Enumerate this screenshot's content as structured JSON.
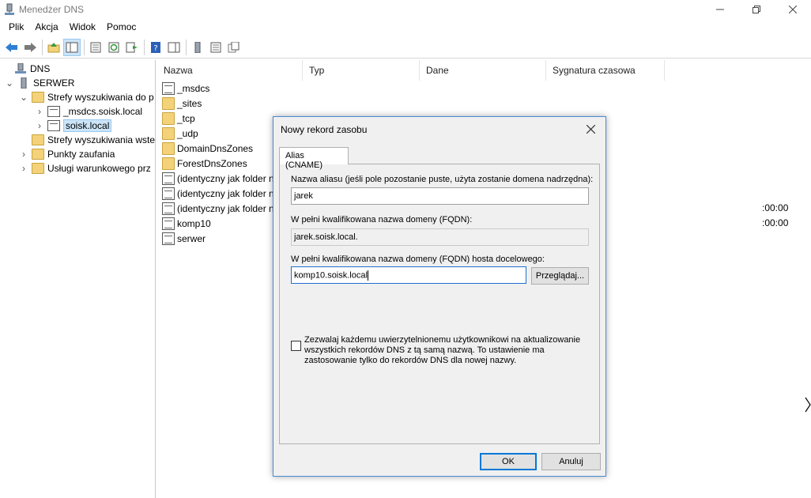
{
  "window": {
    "title": "Menedżer DNS"
  },
  "menu": [
    "Plik",
    "Akcja",
    "Widok",
    "Pomoc"
  ],
  "tree": {
    "root": "DNS",
    "server": "SERWER",
    "items": [
      {
        "label": "Strefy wyszukiwania do p"
      },
      {
        "label": "_msdcs.soisk.local"
      },
      {
        "label": "soisk.local"
      },
      {
        "label": "Strefy wyszukiwania wste"
      },
      {
        "label": "Punkty zaufania"
      },
      {
        "label": "Usługi warunkowego prz"
      }
    ]
  },
  "list": {
    "columns": [
      "Nazwa",
      "Typ",
      "Dane",
      "Sygnatura czasowa"
    ],
    "rows": [
      {
        "name": "_msdcs"
      },
      {
        "name": "_sites"
      },
      {
        "name": "_tcp"
      },
      {
        "name": "_udp"
      },
      {
        "name": "DomainDnsZones"
      },
      {
        "name": "ForestDnsZones"
      },
      {
        "name": "(identyczny jak folder n"
      },
      {
        "name": "(identyczny jak folder n"
      },
      {
        "name": "(identyczny jak folder n",
        "ts": ":00:00"
      },
      {
        "name": "komp10",
        "ts": ":00:00"
      },
      {
        "name": "serwer"
      }
    ]
  },
  "dialog": {
    "title": "Nowy rekord zasobu",
    "tab": "Alias (CNAME)",
    "alias_label": "Nazwa aliasu (jeśli pole pozostanie puste, użyta zostanie domena nadrzędna):",
    "alias_value": "jarek",
    "fqdn_label": "W pełni kwalifikowana nazwa domeny (FQDN):",
    "fqdn_value": "jarek.soisk.local.",
    "target_label": "W pełni kwalifikowana nazwa domeny (FQDN) hosta docelowego:",
    "target_value": "komp10.soisk.local",
    "browse": "Przeglądaj...",
    "checkbox_label": "Zezwalaj każdemu uwierzytelnionemu użytkownikowi na aktualizowanie wszystkich rekordów DNS z tą samą nazwą. To ustawienie ma zastosowanie tylko do rekordów DNS dla nowej nazwy.",
    "checkbox_checked": false,
    "ok": "OK",
    "cancel": "Anuluj"
  }
}
